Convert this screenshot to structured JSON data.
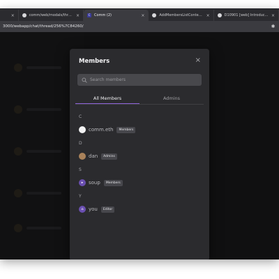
{
  "browser": {
    "tabs": [
      {
        "title": "",
        "active": false
      },
      {
        "title": "comm/web/modals/threads/t",
        "active": false
      },
      {
        "title": "Comm (2)",
        "active": true
      },
      {
        "title": "AddMembersListContent.js",
        "active": false
      },
      {
        "title": "D10901 [web] Introduce t",
        "active": false
      }
    ],
    "close_glyph": "×",
    "url": "3000/webapp/chat/thread/256%7C84260/"
  },
  "modal": {
    "title": "Members",
    "close_glyph": "×",
    "search_placeholder": "Search members",
    "tabs": [
      "All Members",
      "Admins"
    ],
    "sections": [
      {
        "letter": "C",
        "members": [
          {
            "name": "comm.eth",
            "role": "Members",
            "avatar_color": "#f2f2f2",
            "avatar_text": ""
          }
        ]
      },
      {
        "letter": "D",
        "members": [
          {
            "name": "dan",
            "role": "Admins",
            "avatar_color": "#a9825a",
            "avatar_text": ""
          }
        ]
      },
      {
        "letter": "S",
        "members": [
          {
            "name": "soup",
            "role": "Members",
            "avatar_color": "#6a4fb0",
            "avatar_text": "▸"
          }
        ]
      },
      {
        "letter": "Y",
        "members": [
          {
            "name": "you",
            "role": "Editor",
            "avatar_color": "#6a4fb0",
            "avatar_text": "⌂"
          }
        ]
      }
    ]
  },
  "colors": {
    "accent": "#8e63d9",
    "modal_bg": "#2b2b2e",
    "search_bg": "#48484c"
  }
}
